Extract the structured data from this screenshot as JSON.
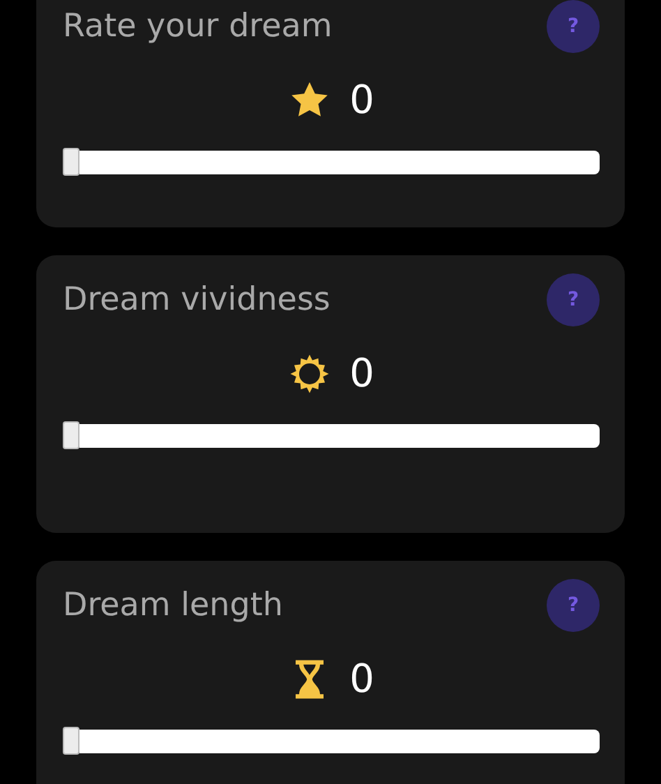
{
  "cards": [
    {
      "title": "Rate your dream",
      "kind": "star",
      "value": "0",
      "level": 0,
      "help": "?"
    },
    {
      "title": "Dream vividness",
      "kind": "sun",
      "value": "0",
      "level": 0,
      "help": "?"
    },
    {
      "title": "Dream length",
      "kind": "hourglass",
      "value": "0",
      "level": 0,
      "help": "?"
    }
  ]
}
